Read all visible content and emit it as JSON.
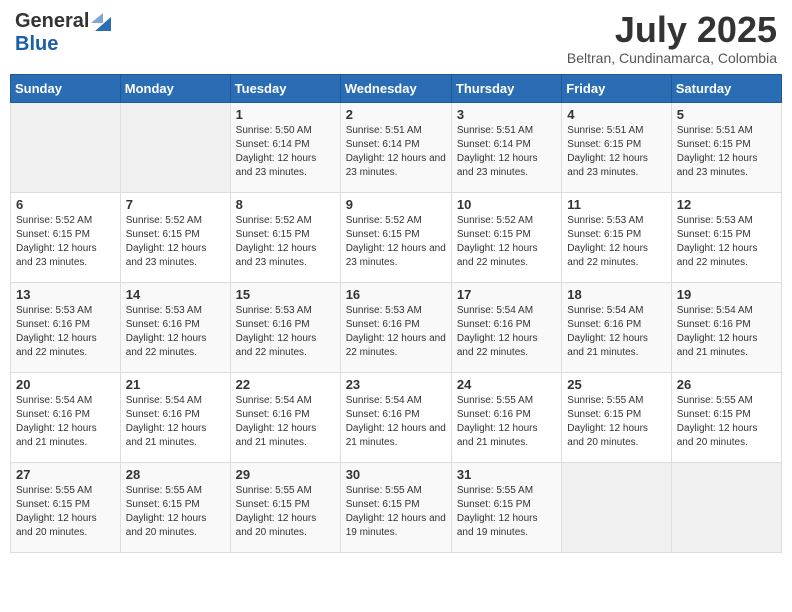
{
  "header": {
    "logo_general": "General",
    "logo_blue": "Blue",
    "title": "July 2025",
    "location": "Beltran, Cundinamarca, Colombia"
  },
  "weekdays": [
    "Sunday",
    "Monday",
    "Tuesday",
    "Wednesday",
    "Thursday",
    "Friday",
    "Saturday"
  ],
  "weeks": [
    [
      {
        "day": "",
        "info": ""
      },
      {
        "day": "",
        "info": ""
      },
      {
        "day": "1",
        "info": "Sunrise: 5:50 AM\nSunset: 6:14 PM\nDaylight: 12 hours and 23 minutes."
      },
      {
        "day": "2",
        "info": "Sunrise: 5:51 AM\nSunset: 6:14 PM\nDaylight: 12 hours and 23 minutes."
      },
      {
        "day": "3",
        "info": "Sunrise: 5:51 AM\nSunset: 6:14 PM\nDaylight: 12 hours and 23 minutes."
      },
      {
        "day": "4",
        "info": "Sunrise: 5:51 AM\nSunset: 6:15 PM\nDaylight: 12 hours and 23 minutes."
      },
      {
        "day": "5",
        "info": "Sunrise: 5:51 AM\nSunset: 6:15 PM\nDaylight: 12 hours and 23 minutes."
      }
    ],
    [
      {
        "day": "6",
        "info": "Sunrise: 5:52 AM\nSunset: 6:15 PM\nDaylight: 12 hours and 23 minutes."
      },
      {
        "day": "7",
        "info": "Sunrise: 5:52 AM\nSunset: 6:15 PM\nDaylight: 12 hours and 23 minutes."
      },
      {
        "day": "8",
        "info": "Sunrise: 5:52 AM\nSunset: 6:15 PM\nDaylight: 12 hours and 23 minutes."
      },
      {
        "day": "9",
        "info": "Sunrise: 5:52 AM\nSunset: 6:15 PM\nDaylight: 12 hours and 23 minutes."
      },
      {
        "day": "10",
        "info": "Sunrise: 5:52 AM\nSunset: 6:15 PM\nDaylight: 12 hours and 22 minutes."
      },
      {
        "day": "11",
        "info": "Sunrise: 5:53 AM\nSunset: 6:15 PM\nDaylight: 12 hours and 22 minutes."
      },
      {
        "day": "12",
        "info": "Sunrise: 5:53 AM\nSunset: 6:15 PM\nDaylight: 12 hours and 22 minutes."
      }
    ],
    [
      {
        "day": "13",
        "info": "Sunrise: 5:53 AM\nSunset: 6:16 PM\nDaylight: 12 hours and 22 minutes."
      },
      {
        "day": "14",
        "info": "Sunrise: 5:53 AM\nSunset: 6:16 PM\nDaylight: 12 hours and 22 minutes."
      },
      {
        "day": "15",
        "info": "Sunrise: 5:53 AM\nSunset: 6:16 PM\nDaylight: 12 hours and 22 minutes."
      },
      {
        "day": "16",
        "info": "Sunrise: 5:53 AM\nSunset: 6:16 PM\nDaylight: 12 hours and 22 minutes."
      },
      {
        "day": "17",
        "info": "Sunrise: 5:54 AM\nSunset: 6:16 PM\nDaylight: 12 hours and 22 minutes."
      },
      {
        "day": "18",
        "info": "Sunrise: 5:54 AM\nSunset: 6:16 PM\nDaylight: 12 hours and 21 minutes."
      },
      {
        "day": "19",
        "info": "Sunrise: 5:54 AM\nSunset: 6:16 PM\nDaylight: 12 hours and 21 minutes."
      }
    ],
    [
      {
        "day": "20",
        "info": "Sunrise: 5:54 AM\nSunset: 6:16 PM\nDaylight: 12 hours and 21 minutes."
      },
      {
        "day": "21",
        "info": "Sunrise: 5:54 AM\nSunset: 6:16 PM\nDaylight: 12 hours and 21 minutes."
      },
      {
        "day": "22",
        "info": "Sunrise: 5:54 AM\nSunset: 6:16 PM\nDaylight: 12 hours and 21 minutes."
      },
      {
        "day": "23",
        "info": "Sunrise: 5:54 AM\nSunset: 6:16 PM\nDaylight: 12 hours and 21 minutes."
      },
      {
        "day": "24",
        "info": "Sunrise: 5:55 AM\nSunset: 6:16 PM\nDaylight: 12 hours and 21 minutes."
      },
      {
        "day": "25",
        "info": "Sunrise: 5:55 AM\nSunset: 6:15 PM\nDaylight: 12 hours and 20 minutes."
      },
      {
        "day": "26",
        "info": "Sunrise: 5:55 AM\nSunset: 6:15 PM\nDaylight: 12 hours and 20 minutes."
      }
    ],
    [
      {
        "day": "27",
        "info": "Sunrise: 5:55 AM\nSunset: 6:15 PM\nDaylight: 12 hours and 20 minutes."
      },
      {
        "day": "28",
        "info": "Sunrise: 5:55 AM\nSunset: 6:15 PM\nDaylight: 12 hours and 20 minutes."
      },
      {
        "day": "29",
        "info": "Sunrise: 5:55 AM\nSunset: 6:15 PM\nDaylight: 12 hours and 20 minutes."
      },
      {
        "day": "30",
        "info": "Sunrise: 5:55 AM\nSunset: 6:15 PM\nDaylight: 12 hours and 19 minutes."
      },
      {
        "day": "31",
        "info": "Sunrise: 5:55 AM\nSunset: 6:15 PM\nDaylight: 12 hours and 19 minutes."
      },
      {
        "day": "",
        "info": ""
      },
      {
        "day": "",
        "info": ""
      }
    ]
  ]
}
